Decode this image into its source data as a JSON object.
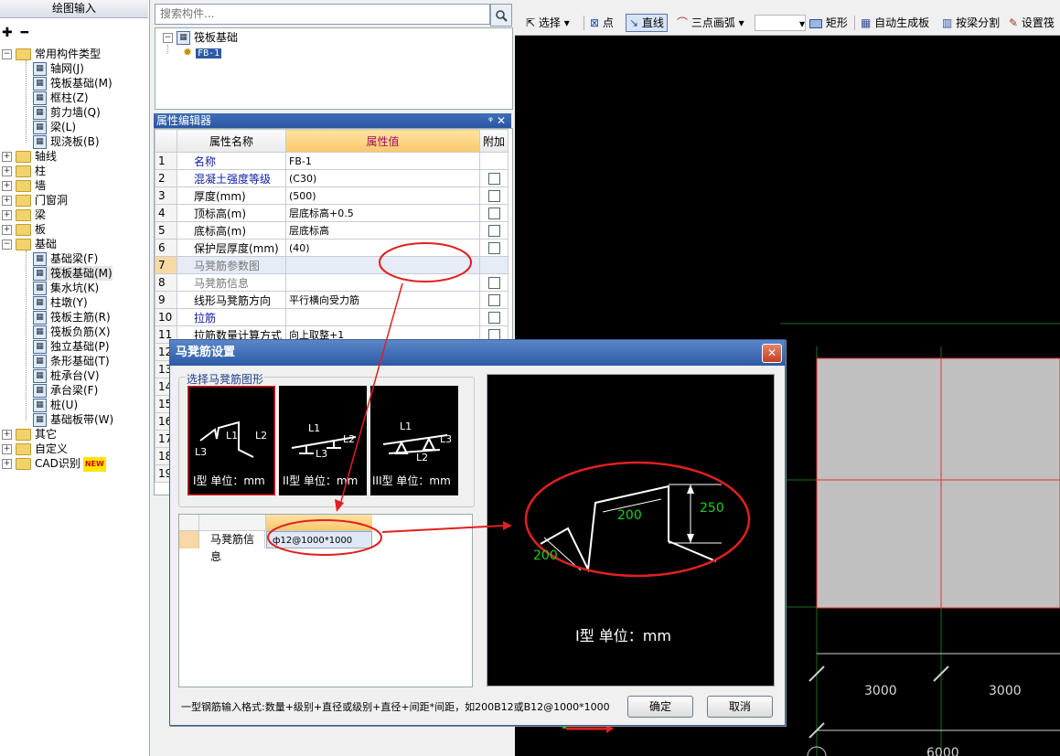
{
  "left_panel": {
    "title": "绘图输入",
    "tools": "✚ ━",
    "tree": [
      {
        "label": "常用构件类型",
        "level": 0,
        "expanded": true
      },
      {
        "label": "轴网(J)",
        "level": 1,
        "icon": "grid-icon"
      },
      {
        "label": "筏板基础(M)",
        "level": 1,
        "icon": "raft-icon"
      },
      {
        "label": "框柱(Z)",
        "level": 1,
        "icon": "column-icon"
      },
      {
        "label": "剪力墙(Q)",
        "level": 1,
        "icon": "wall-icon"
      },
      {
        "label": "梁(L)",
        "level": 1,
        "icon": "beam-icon"
      },
      {
        "label": "现浇板(B)",
        "level": 1,
        "icon": "slab-icon"
      },
      {
        "label": "轴线",
        "level": 0
      },
      {
        "label": "柱",
        "level": 0
      },
      {
        "label": "墙",
        "level": 0
      },
      {
        "label": "门窗洞",
        "level": 0
      },
      {
        "label": "梁",
        "level": 0
      },
      {
        "label": "板",
        "level": 0
      },
      {
        "label": "基础",
        "level": 0,
        "expanded": true
      },
      {
        "label": "基础梁(F)",
        "level": 1,
        "icon": "foundation-beam-icon"
      },
      {
        "label": "筏板基础(M)",
        "level": 1,
        "icon": "raft-icon",
        "selected": true
      },
      {
        "label": "集水坑(K)",
        "level": 1,
        "icon": "sump-icon"
      },
      {
        "label": "柱墩(Y)",
        "level": 1,
        "icon": "pier-icon"
      },
      {
        "label": "筏板主筋(R)",
        "level": 1,
        "icon": "main-rebar-icon"
      },
      {
        "label": "筏板负筋(X)",
        "level": 1,
        "icon": "neg-rebar-icon"
      },
      {
        "label": "独立基础(P)",
        "level": 1,
        "icon": "isolated-footing-icon"
      },
      {
        "label": "条形基础(T)",
        "level": 1,
        "icon": "strip-footing-icon"
      },
      {
        "label": "桩承台(V)",
        "level": 1,
        "icon": "pile-cap-icon"
      },
      {
        "label": "承台梁(F)",
        "level": 1,
        "icon": "cap-beam-icon"
      },
      {
        "label": "桩(U)",
        "level": 1,
        "icon": "pile-icon"
      },
      {
        "label": "基础板带(W)",
        "level": 1,
        "icon": "strip-icon"
      },
      {
        "label": "其它",
        "level": 0
      },
      {
        "label": "自定义",
        "level": 0
      },
      {
        "label": "CAD识别",
        "level": 0,
        "badge": "NEW"
      }
    ]
  },
  "search": {
    "placeholder": "搜索构件..."
  },
  "component_tree": {
    "root": "筏板基础",
    "child": "FB-1"
  },
  "property_editor": {
    "title": "属性编辑器",
    "headers": [
      "属性名称",
      "属性值",
      "附加"
    ],
    "rows": [
      {
        "n": "1",
        "name": "名称",
        "value": "FB-1",
        "cb": false,
        "style": "blue"
      },
      {
        "n": "2",
        "name": "混凝土强度等级",
        "value": "(C30)",
        "cb": true,
        "style": "blue"
      },
      {
        "n": "3",
        "name": "厚度(mm)",
        "value": "(500)",
        "cb": true,
        "style": ""
      },
      {
        "n": "4",
        "name": "顶标高(m)",
        "value": "层底标高+0.5",
        "cb": true,
        "style": ""
      },
      {
        "n": "5",
        "name": "底标高(m)",
        "value": "层底标高",
        "cb": true,
        "style": ""
      },
      {
        "n": "6",
        "name": "保护层厚度(mm)",
        "value": "(40)",
        "cb": true,
        "style": ""
      },
      {
        "n": "7",
        "name": "马凳筋参数图",
        "value": "",
        "cb": false,
        "style": "gray",
        "hi": true
      },
      {
        "n": "8",
        "name": "马凳筋信息",
        "value": "",
        "cb": true,
        "style": "gray"
      },
      {
        "n": "9",
        "name": "线形马凳筋方向",
        "value": "平行横向受力筋",
        "cb": true,
        "style": ""
      },
      {
        "n": "10",
        "name": "拉筋",
        "value": "",
        "cb": true,
        "style": "blue"
      },
      {
        "n": "11",
        "name": "拉筋数量计算方式",
        "value": "向上取整+1",
        "cb": true,
        "style": ""
      },
      {
        "n": "12",
        "name": "",
        "value": "",
        "cb": false,
        "style": ""
      },
      {
        "n": "13",
        "name": "",
        "value": "",
        "cb": false,
        "style": ""
      },
      {
        "n": "14",
        "name": "",
        "value": "",
        "cb": false,
        "style": ""
      },
      {
        "n": "15",
        "name": "",
        "value": "",
        "cb": false,
        "style": ""
      },
      {
        "n": "16",
        "name": "",
        "value": "",
        "cb": false,
        "style": ""
      },
      {
        "n": "17",
        "name": "",
        "value": "",
        "cb": false,
        "style": ""
      },
      {
        "n": "18",
        "name": "",
        "value": "",
        "cb": false,
        "style": ""
      },
      {
        "n": "19",
        "name": "",
        "value": "",
        "cb": false,
        "style": ""
      }
    ]
  },
  "toolbar": {
    "select": "选择",
    "point": "点",
    "line": "直线",
    "arc": "三点画弧",
    "rect": "矩形",
    "auto_slab": "自动生成板",
    "split_by_beam": "按梁分割",
    "set_slope": "设置筏"
  },
  "canvas": {
    "dim_left": "3000",
    "dim_right": "3000",
    "dim_total": "6000"
  },
  "dialog": {
    "title": "马凳筋设置",
    "group_label": "选择马凳筋图形",
    "shapes": [
      {
        "label": "I型 单位：mm",
        "selected": true
      },
      {
        "label": "II型 单位：mm",
        "selected": false
      },
      {
        "label": "III型 单位：mm",
        "selected": false
      }
    ],
    "shape_parts": {
      "l1": "L1",
      "l2": "L2",
      "l3": "L3"
    },
    "info_row_label": "马凳筋信息",
    "info_row_value": "ф12@1000*1000",
    "preview": {
      "dim_top": "200",
      "dim_height": "250",
      "dim_bottom": "200",
      "caption": "I型 单位：mm"
    },
    "hint": "一型钢筋输入格式:数量+级别+直径或级别+直径+间距*间距，如200B12或B12@1000*1000",
    "ok": "确定",
    "cancel": "取消"
  },
  "colors": {
    "annotation_red": "#e02020",
    "canvas_bg": "#000000",
    "selected_border": "#d81818"
  }
}
